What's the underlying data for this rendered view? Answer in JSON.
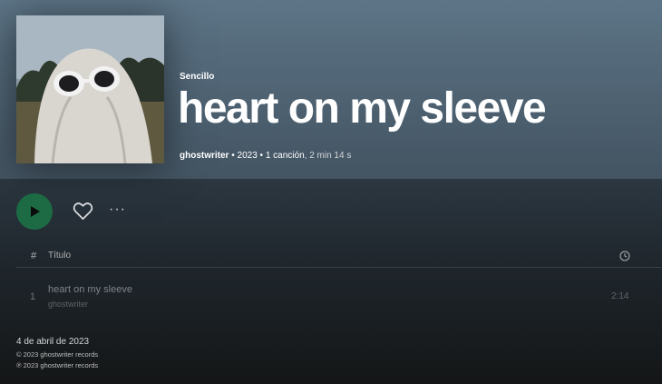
{
  "album": {
    "type_label": "Sencillo",
    "title": "heart on my sleeve",
    "artist": "ghostwriter",
    "year": "2023",
    "tracks_summary": "1 canción",
    "duration_summary": "2 min 14 s",
    "cover_icon": "ghost-sheet-sunglasses-image"
  },
  "actions": {
    "play_icon": "play-icon",
    "like_icon": "heart-outline-icon",
    "more_label": "···",
    "play_color": "#1d6b44"
  },
  "tracklist": {
    "header_num": "#",
    "header_title": "Título",
    "header_duration_icon": "clock-icon",
    "tracks": [
      {
        "num": "1",
        "title": "heart on my sleeve",
        "artist": "ghostwriter",
        "duration": "2:14"
      }
    ]
  },
  "footer": {
    "release_date": "4 de abril de 2023",
    "copyright_c": "© 2023 ghostwriter records",
    "copyright_p": "℗ 2023 ghostwriter records"
  },
  "colors": {
    "hero_top": "#5d7587",
    "background": "#121212"
  }
}
